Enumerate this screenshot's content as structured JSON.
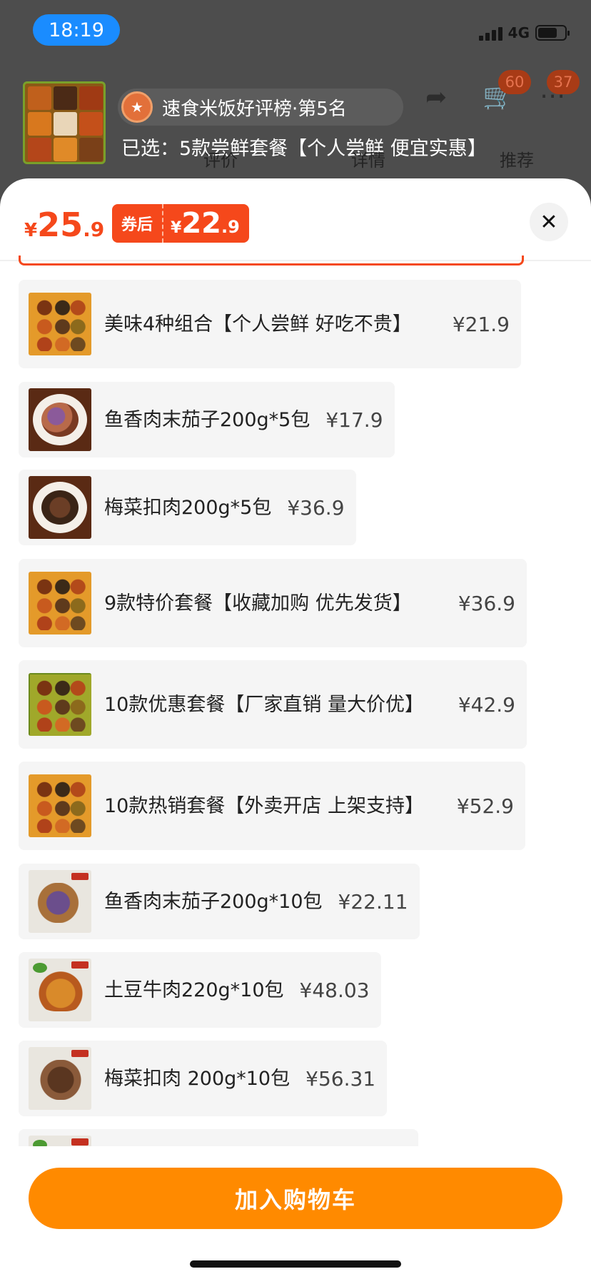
{
  "status": {
    "time": "18:19",
    "network": "4G"
  },
  "background": {
    "rank_text": "速食米饭好评榜·第5名",
    "selected_text": "已选：5款尝鲜套餐【个人尝鲜 便宜实惠】",
    "cart_badge": "60",
    "more_badge": "37",
    "tabs": [
      "评价",
      "详情",
      "推荐"
    ]
  },
  "price": {
    "currency": "¥",
    "original_int": "25",
    "original_dec": ".9",
    "coupon_label": "券后",
    "coupon_int": "22",
    "coupon_dec": ".9"
  },
  "close_label": "✕",
  "items": [
    {
      "name": "美味4种组合【个人尝鲜 好吃不贵】",
      "price": "¥21.9"
    },
    {
      "name": "鱼香肉末茄子200g*5包",
      "price": "¥17.9"
    },
    {
      "name": "梅菜扣肉200g*5包",
      "price": "¥36.9"
    },
    {
      "name": "9款特价套餐【收藏加购 优先发货】",
      "price": "¥36.9"
    },
    {
      "name": "10款优惠套餐【厂家直销 量大价优】",
      "price": "¥42.9"
    },
    {
      "name": "10款热销套餐【外卖开店 上架支持】",
      "price": "¥52.9"
    },
    {
      "name": "鱼香肉末茄子200g*10包",
      "price": "¥22.11"
    },
    {
      "name": "土豆牛肉220g*10包",
      "price": "¥48.03"
    },
    {
      "name": "梅菜扣肉 200g*10包",
      "price": "¥56.31"
    }
  ],
  "cta": {
    "label": "加入购物车"
  },
  "colors": {
    "accent": "#f5481b",
    "cta": "#ff8a00",
    "status_pill": "#1a8cff"
  }
}
